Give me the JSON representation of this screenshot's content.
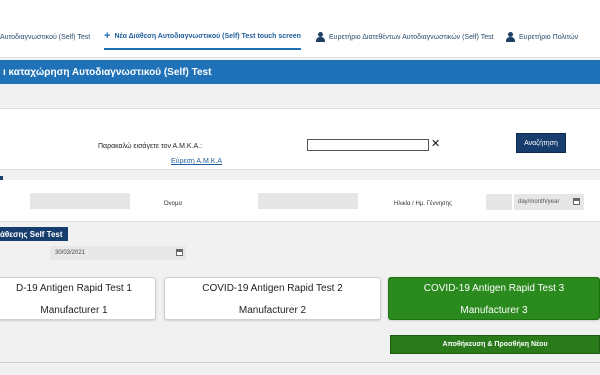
{
  "tabs": [
    {
      "label": "Αυτοδιαγνωστικού (Self) Test",
      "icon": "none"
    },
    {
      "label": "Νέα Διάθεση Αυτοδιαγνωστικού (Self) Test touch screen",
      "icon": "plus-icon"
    },
    {
      "label": "Ευρετήριο Διατεθέντων Αυτοδιαγνωστικών (Self) Test",
      "icon": "person-icon"
    },
    {
      "label": "Ευρετήριο Πολιτών",
      "icon": "person-icon"
    }
  ],
  "page_title": "ι καταχώρηση Αυτοδιαγνωστικού (Self) Test",
  "search": {
    "amka_label": "Παρακαλώ εισάγετε τον Α.Μ.Κ.Α.:",
    "amka_value": "",
    "clear_symbol": "✕",
    "find_link": "Εύρεση Α.Μ.Κ.Α",
    "button": "Αναζήτηση"
  },
  "person": {
    "name_label": "Όνομα",
    "age_label": "Ηλικία / Ημ. Γέννησης",
    "date_placeholder": "day/month/year"
  },
  "self_test": {
    "section_label": "άθεσης Self Test",
    "date_value": "30/03/2021",
    "cards": [
      {
        "line1": "D-19 Antigen Rapid Test 1",
        "line2": "Manufacturer 1",
        "selected": false
      },
      {
        "line1": "COVID-19 Antigen Rapid Test 2",
        "line2": "Manufacturer 2",
        "selected": false
      },
      {
        "line1": "COVID-19 Antigen Rapid Test 3",
        "line2": "Manufacturer 3",
        "selected": true
      }
    ],
    "save_button": "Αποθήκευση & Προσθήκη Νέου"
  },
  "colors": {
    "accent": "#1f72b8",
    "dark_blue": "#163d6e",
    "selected_green": "#2a8a1e"
  }
}
